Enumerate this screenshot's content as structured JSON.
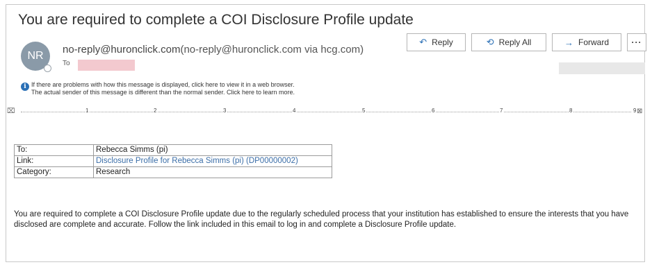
{
  "email": {
    "subject": "You are required to complete a COI Disclosure Profile update",
    "avatar_initials": "NR",
    "sender_address": "no-reply@huronclick.com",
    "sender_via": "(no-reply@huronclick.com via hcg.com)",
    "to_label": "To",
    "info_line1": "If there are problems with how this message is displayed, click here to view it in a web browser.",
    "info_line2": "The actual sender of this message is different than the normal sender. Click here to learn more."
  },
  "actions": {
    "reply": "Reply",
    "reply_all": "Reply All",
    "forward": "Forward",
    "more": "···"
  },
  "ruler": {
    "left_marker": "⌧",
    "numbers": [
      "1",
      "2",
      "3",
      "4",
      "5",
      "6",
      "7",
      "8",
      "9"
    ],
    "right_marker": "⊠"
  },
  "details_table": [
    {
      "label": "To:",
      "value": "Rebecca Simms (pi)"
    },
    {
      "label": "Link:",
      "value": "Disclosure Profile for Rebecca Simms (pi) (DP00000002)"
    },
    {
      "label": "Category:",
      "value": "Research"
    }
  ],
  "message_body": "You are required to complete a COI Disclosure Profile update due to the regularly scheduled process that your institution has established to ensure the interests that you have disclosed are complete and accurate. Follow the link included in this email to log in and complete a Disclosure Profile update.",
  "colors": {
    "accent": "#2a6fb5",
    "link": "#3b6ea8",
    "avatar": "#8a9aa8",
    "redaction": "#f3c9cf"
  },
  "icons": {
    "reply": "reply-arrow-icon",
    "reply_all": "reply-all-arrow-icon",
    "forward": "forward-arrow-icon",
    "info": "info-icon"
  }
}
